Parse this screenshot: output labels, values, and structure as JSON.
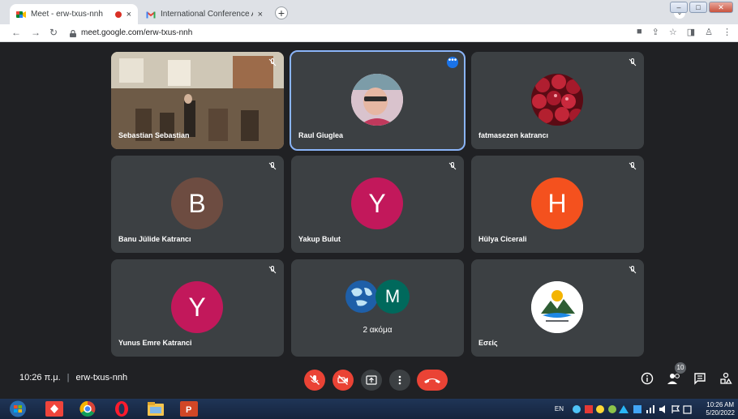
{
  "browser": {
    "tabs": [
      {
        "title": "Meet - erw-txus-nnh",
        "close": "×"
      },
      {
        "title": "International Conference Agenda",
        "close": "×"
      }
    ],
    "new_tab": "+",
    "url": "meet.google.com/erw-txus-nnh"
  },
  "participants": [
    {
      "name": "Sebastian Sebastian",
      "type": "video"
    },
    {
      "name": "Raul Giuglea",
      "type": "photo",
      "speaking": true
    },
    {
      "name": "fatmasezen katrancı",
      "type": "photo"
    },
    {
      "name": "Banu Jülide Katrancı",
      "initial": "B",
      "color": "#6d4c41"
    },
    {
      "name": "Yakup Bulut",
      "initial": "Y",
      "color": "#c2185b"
    },
    {
      "name": "Hülya Cicerali",
      "initial": "H",
      "color": "#f4511e"
    },
    {
      "name": "Yunus Emre Katranci",
      "initial": "Y",
      "color": "#c2185b"
    },
    {
      "group_label": "2 ακόμα",
      "initial": "M",
      "color": "#00695c"
    },
    {
      "name": "Εσείς",
      "type": "logo"
    }
  ],
  "bottom": {
    "time": "10:26 π.μ.",
    "separator": "|",
    "meeting_code": "erw-txus-nnh",
    "participant_count": "10"
  },
  "taskbar": {
    "lang": "EN",
    "clock_time": "10:26 AM",
    "clock_date": "5/20/2022"
  },
  "colors": {
    "background": "#202124",
    "tile": "#3c4043",
    "red": "#ea4335",
    "speaking_outline": "#8ab4f8"
  }
}
